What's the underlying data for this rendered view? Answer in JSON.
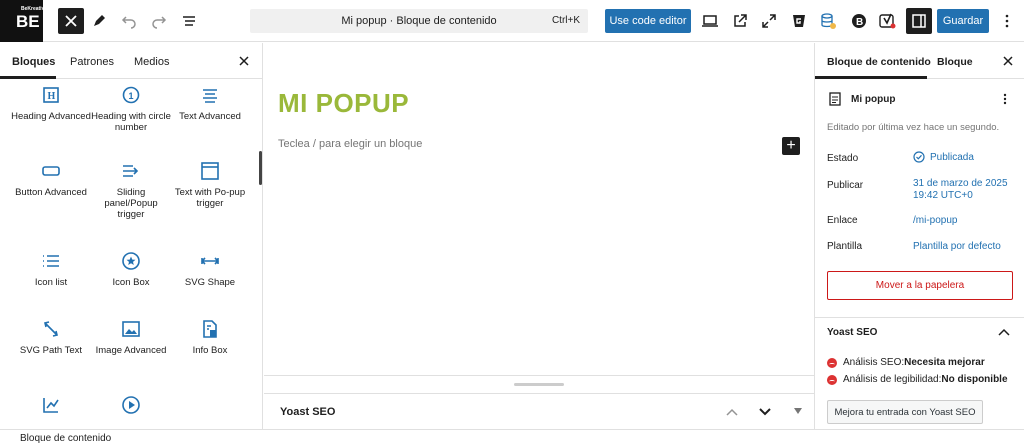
{
  "logo": {
    "small": "BeKreativ",
    "big": "BE"
  },
  "toolbar": {
    "command_title": "Mi popup · Bloque de contenido",
    "shortcut": "Ctrl+K",
    "code_editor": "Use code editor",
    "save": "Guardar"
  },
  "inserter": {
    "tabs": [
      "Bloques",
      "Patrones",
      "Medios"
    ],
    "blocks": [
      {
        "label": "Heading Advanced",
        "icon": "heading-icon"
      },
      {
        "label": "Heading with circle number",
        "icon": "circle-number-icon"
      },
      {
        "label": "Text Advanced",
        "icon": "text-align-icon"
      },
      {
        "label": "Button Advanced",
        "icon": "button-icon"
      },
      {
        "label": "Sliding panel/Popup trigger",
        "icon": "arrow-lines-icon"
      },
      {
        "label": "Text with Po-pup trigger",
        "icon": "window-icon"
      },
      {
        "label": "Icon list",
        "icon": "list-icon"
      },
      {
        "label": "Icon Box",
        "icon": "star-circle-icon"
      },
      {
        "label": "SVG Shape",
        "icon": "arrows-horizontal-icon"
      },
      {
        "label": "SVG Path Text",
        "icon": "path-icon"
      },
      {
        "label": "Image Advanced",
        "icon": "image-icon"
      },
      {
        "label": "Info Box",
        "icon": "info-doc-icon"
      },
      {
        "label": "",
        "icon": "chart-icon"
      },
      {
        "label": "",
        "icon": "play-icon"
      }
    ]
  },
  "canvas": {
    "title": "MI POPUP",
    "placeholder": "Teclea / para elegir un bloque",
    "yoast_label": "Yoast SEO"
  },
  "sidebar": {
    "tabs": [
      "Bloque de contenido",
      "Bloque"
    ],
    "post_title": "Mi popup",
    "edited": "Editado por última vez hace un segundo.",
    "rows": [
      {
        "label": "Estado",
        "value": "Publicada"
      },
      {
        "label": "Publicar",
        "value": "31 de marzo de 2025 19:42 UTC+0"
      },
      {
        "label": "Enlace",
        "value": "/mi-popup"
      },
      {
        "label": "Plantilla",
        "value": "Plantilla por defecto"
      }
    ],
    "trash": "Mover a la papelera",
    "yoast": {
      "title": "Yoast SEO",
      "seo_prefix": "Análisis SEO: ",
      "seo_value": "Necesita mejorar",
      "read_prefix": "Análisis de legibilidad: ",
      "read_value": "No disponible",
      "button": "Mejora tu entrada con Yoast SEO"
    }
  },
  "footer": {
    "breadcrumb": "Bloque de contenido"
  },
  "colors": {
    "accent": "#2271b1",
    "title": "#9ab83a",
    "danger": "#cc1818"
  }
}
